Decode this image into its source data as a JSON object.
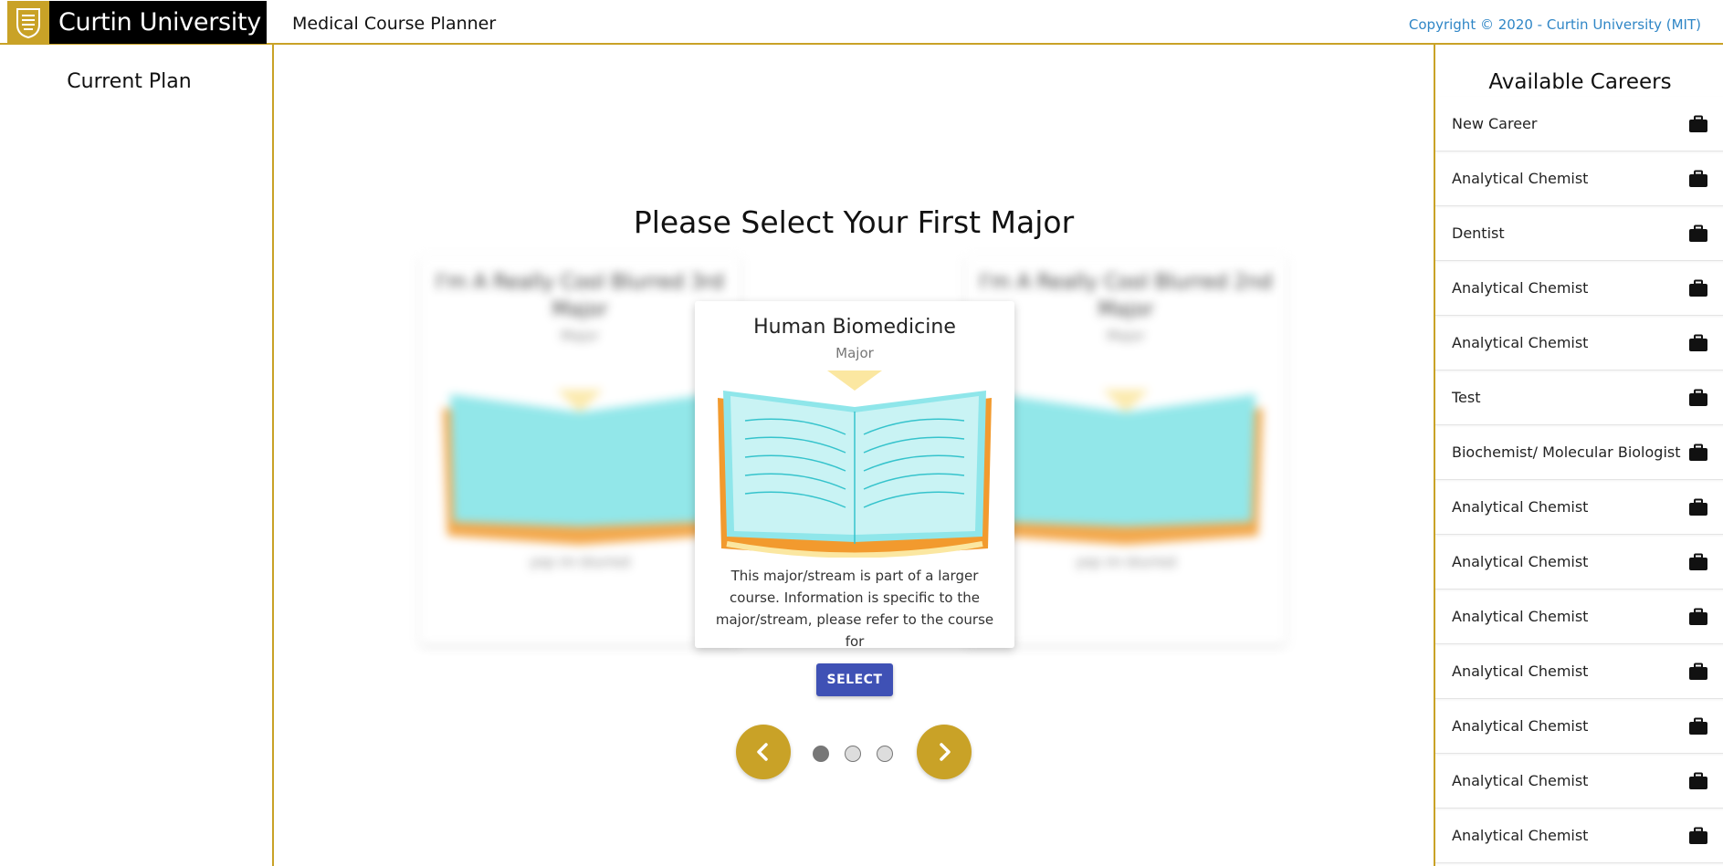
{
  "header": {
    "logo_text": "Curtin University",
    "app_title": "Medical Course Planner",
    "copyright": "Copyright © 2020 - Curtin University (MIT)"
  },
  "left_panel": {
    "title": "Current Plan"
  },
  "main": {
    "title": "Please Select Your First Major",
    "center_card": {
      "title": "Human Biomedicine",
      "subtitle": "Major",
      "description": "This major/stream is part of a larger course. Information is specific to the major/stream, please refer to the course for"
    },
    "left_card": {
      "title": "I'm A Really Cool Blurred 3rd Major",
      "subtitle": "Major",
      "footer": "yep im blurred"
    },
    "right_card": {
      "title": "I'm A Really Cool Blurred 2nd Major",
      "subtitle": "Major",
      "footer": "yep im blurred"
    },
    "select_label": "SELECT",
    "carousel": {
      "total": 3,
      "active_index": 0
    }
  },
  "right_panel": {
    "title": "Available Careers",
    "items": [
      {
        "label": "New Career",
        "icon": "briefcase-icon"
      },
      {
        "label": "Analytical Chemist",
        "icon": "briefcase-icon"
      },
      {
        "label": "Dentist",
        "icon": "briefcase-icon"
      },
      {
        "label": "Analytical Chemist",
        "icon": "briefcase-icon"
      },
      {
        "label": "Analytical Chemist",
        "icon": "briefcase-icon"
      },
      {
        "label": "Test",
        "icon": "briefcase-icon"
      },
      {
        "label": "Biochemist/ Molecular Biologist",
        "icon": "briefcase-icon"
      },
      {
        "label": "Analytical Chemist",
        "icon": "briefcase-icon"
      },
      {
        "label": "Analytical Chemist",
        "icon": "briefcase-icon"
      },
      {
        "label": "Analytical Chemist",
        "icon": "briefcase-icon"
      },
      {
        "label": "Analytical Chemist",
        "icon": "briefcase-icon"
      },
      {
        "label": "Analytical Chemist",
        "icon": "briefcase-icon"
      },
      {
        "label": "Analytical Chemist",
        "icon": "briefcase-icon"
      },
      {
        "label": "Analytical Chemist",
        "icon": "briefcase-icon"
      }
    ]
  },
  "colors": {
    "accent_gold": "#c9a227",
    "button_blue": "#3f51b5",
    "link_blue": "#2f86c6"
  }
}
